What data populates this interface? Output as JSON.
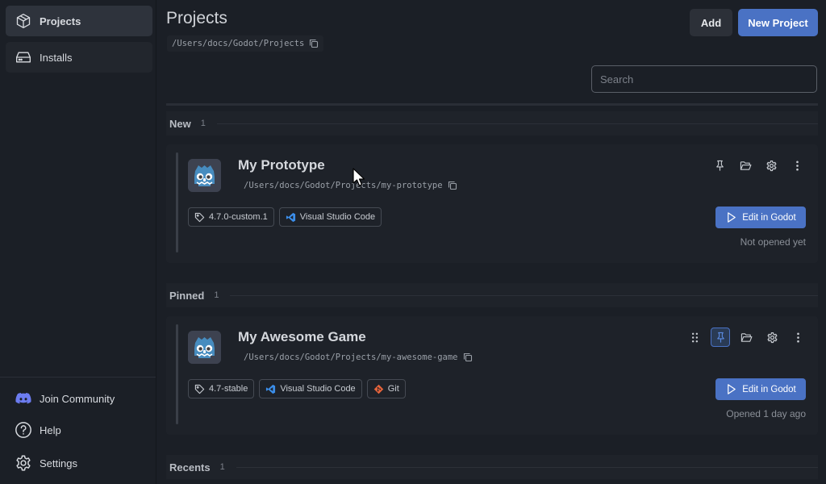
{
  "sidebar": {
    "items": [
      {
        "label": "Projects",
        "icon": "box-icon",
        "active": true
      },
      {
        "label": "Installs",
        "icon": "drive-icon",
        "active": false
      }
    ],
    "footer": [
      {
        "label": "Join Community",
        "icon": "discord-icon"
      },
      {
        "label": "Help",
        "icon": "help-icon"
      },
      {
        "label": "Settings",
        "icon": "gear-icon"
      }
    ]
  },
  "header": {
    "title": "Projects",
    "path": "/Users/docs/Godot/Projects",
    "add_label": "Add",
    "new_project_label": "New Project",
    "search_placeholder": "Search"
  },
  "sections": [
    {
      "label": "New",
      "count": "1"
    },
    {
      "label": "Pinned",
      "count": "1"
    },
    {
      "label": "Recents",
      "count": "1"
    }
  ],
  "projects": [
    {
      "name": "My Prototype",
      "path": "/Users/docs/Godot/Projects/my-prototype",
      "tags": [
        "4.7.0-custom.1",
        "Visual Studio Code"
      ],
      "edit_label": "Edit in Godot",
      "opened": "Not opened yet",
      "pinned": false
    },
    {
      "name": "My Awesome Game",
      "path": "/Users/docs/Godot/Projects/my-awesome-game",
      "tags": [
        "4.7-stable",
        "Visual Studio Code",
        "Git"
      ],
      "edit_label": "Edit in Godot",
      "opened": "Opened 1 day ago",
      "pinned": true
    }
  ],
  "colors": {
    "accent": "#4a72c4",
    "background": "#1b1f26",
    "card": "#1e2229",
    "vscode": "#3b8eea",
    "git": "#e8643b",
    "discord": "#6c7cf0"
  }
}
